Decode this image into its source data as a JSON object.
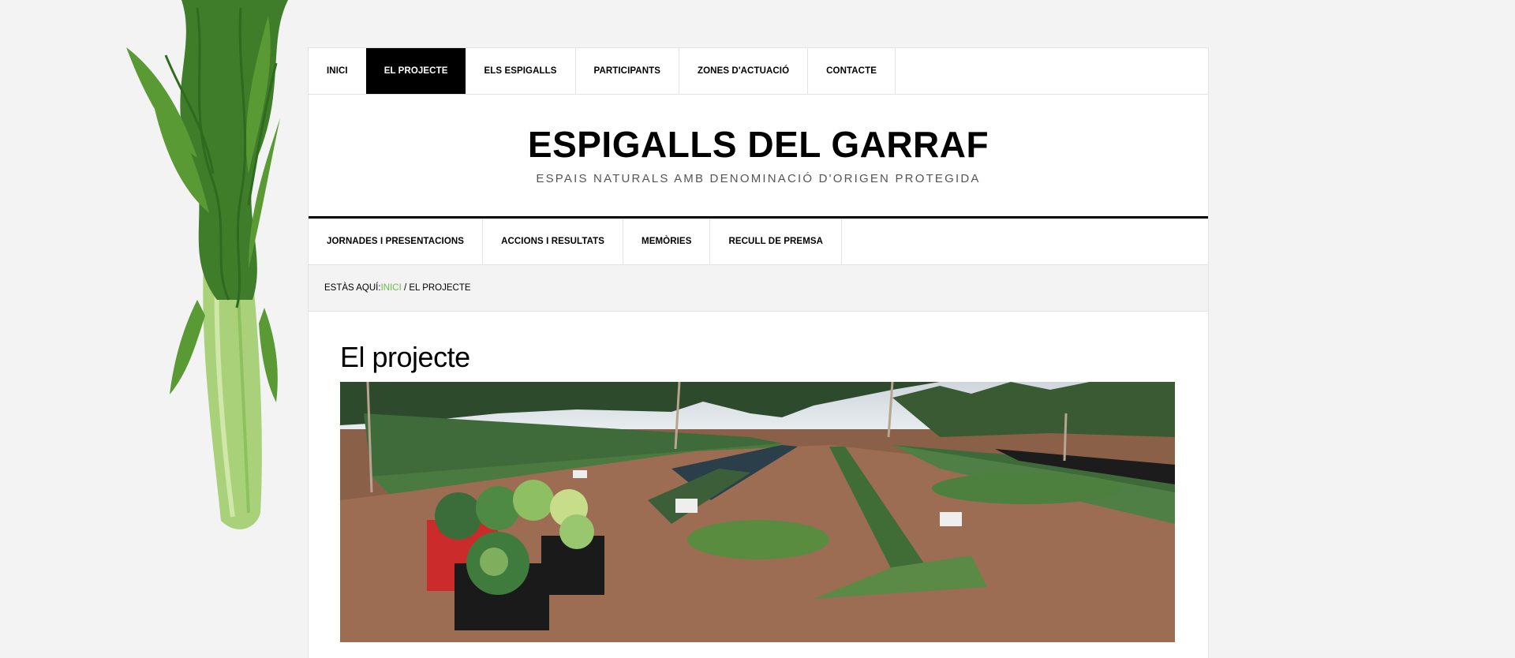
{
  "nav_primary": [
    {
      "label": "INICI"
    },
    {
      "label": "EL PROJECTE",
      "active": true
    },
    {
      "label": "ELS ESPIGALLS"
    },
    {
      "label": "PARTICIPANTS"
    },
    {
      "label": "ZONES D'ACTUACIÓ"
    },
    {
      "label": "CONTACTE"
    }
  ],
  "header": {
    "title": "ESPIGALLS DEL GARRAF",
    "description": "ESPAIS NATURALS AMB DENOMINACIÓ D'ORIGEN PROTEGIDA"
  },
  "nav_secondary": [
    {
      "label": "JORNADES I PRESENTACIONS"
    },
    {
      "label": "ACCIONS I RESULTATS"
    },
    {
      "label": "MEMÒRIES"
    },
    {
      "label": "RECULL DE PREMSA"
    }
  ],
  "breadcrumb": {
    "prefix": "ESTÀS AQUÍ:",
    "home": "INICI",
    "separator": " / ",
    "current": "EL PROJECTE"
  },
  "page": {
    "title": "El projecte"
  },
  "colors": {
    "accent_link": "#6abf4b",
    "active_nav_bg": "#000000",
    "page_bg": "#f3f3f3"
  }
}
